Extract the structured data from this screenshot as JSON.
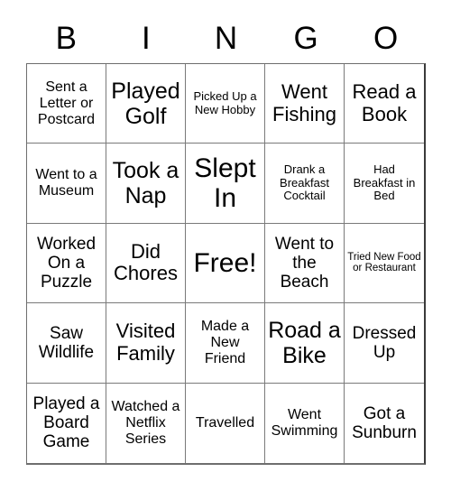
{
  "card": {
    "title_letters": [
      "B",
      "I",
      "N",
      "G",
      "O"
    ],
    "columns": 5,
    "rows": 5,
    "free_space_label": "Free!",
    "free_space_position": "center",
    "colors": {
      "background": "#ffffff",
      "text": "#000000",
      "grid_line": "#7a7a7a",
      "outer_frame": "#3a3a3a"
    },
    "cells": [
      [
        {
          "text": "Sent a Letter or Postcard",
          "size": "sm",
          "free": false
        },
        {
          "text": "Played Golf",
          "size": "xl",
          "free": false
        },
        {
          "text": "Picked Up a New Hobby",
          "size": "xs",
          "free": false
        },
        {
          "text": "Went Fishing",
          "size": "lg",
          "free": false
        },
        {
          "text": "Read a Book",
          "size": "lg",
          "free": false
        }
      ],
      [
        {
          "text": "Went to a Museum",
          "size": "sm",
          "free": false
        },
        {
          "text": "Took a Nap",
          "size": "xl",
          "free": false
        },
        {
          "text": "Slept In",
          "size": "xxl",
          "free": false
        },
        {
          "text": "Drank a Breakfast Cocktail",
          "size": "xs",
          "free": false
        },
        {
          "text": "Had Breakfast in Bed",
          "size": "xs",
          "free": false
        }
      ],
      [
        {
          "text": "Worked On a Puzzle",
          "size": "md",
          "free": false
        },
        {
          "text": "Did Chores",
          "size": "lg",
          "free": false
        },
        {
          "text": "Free!",
          "size": "xxl",
          "free": true
        },
        {
          "text": "Went to the Beach",
          "size": "md",
          "free": false
        },
        {
          "text": "Tried New Food or Restaurant",
          "size": "xxs",
          "free": false
        }
      ],
      [
        {
          "text": "Saw Wildlife",
          "size": "md",
          "free": false
        },
        {
          "text": "Visited Family",
          "size": "lg",
          "free": false
        },
        {
          "text": "Made a New Friend",
          "size": "sm",
          "free": false
        },
        {
          "text": "Road a Bike",
          "size": "xl",
          "free": false
        },
        {
          "text": "Dressed Up",
          "size": "md",
          "free": false
        }
      ],
      [
        {
          "text": "Played a Board Game",
          "size": "md",
          "free": false
        },
        {
          "text": "Watched a Netflix Series",
          "size": "sm",
          "free": false
        },
        {
          "text": "Travelled",
          "size": "sm",
          "free": false
        },
        {
          "text": "Went Swimming",
          "size": "sm",
          "free": false
        },
        {
          "text": "Got a Sunburn",
          "size": "md",
          "free": false
        }
      ]
    ]
  }
}
